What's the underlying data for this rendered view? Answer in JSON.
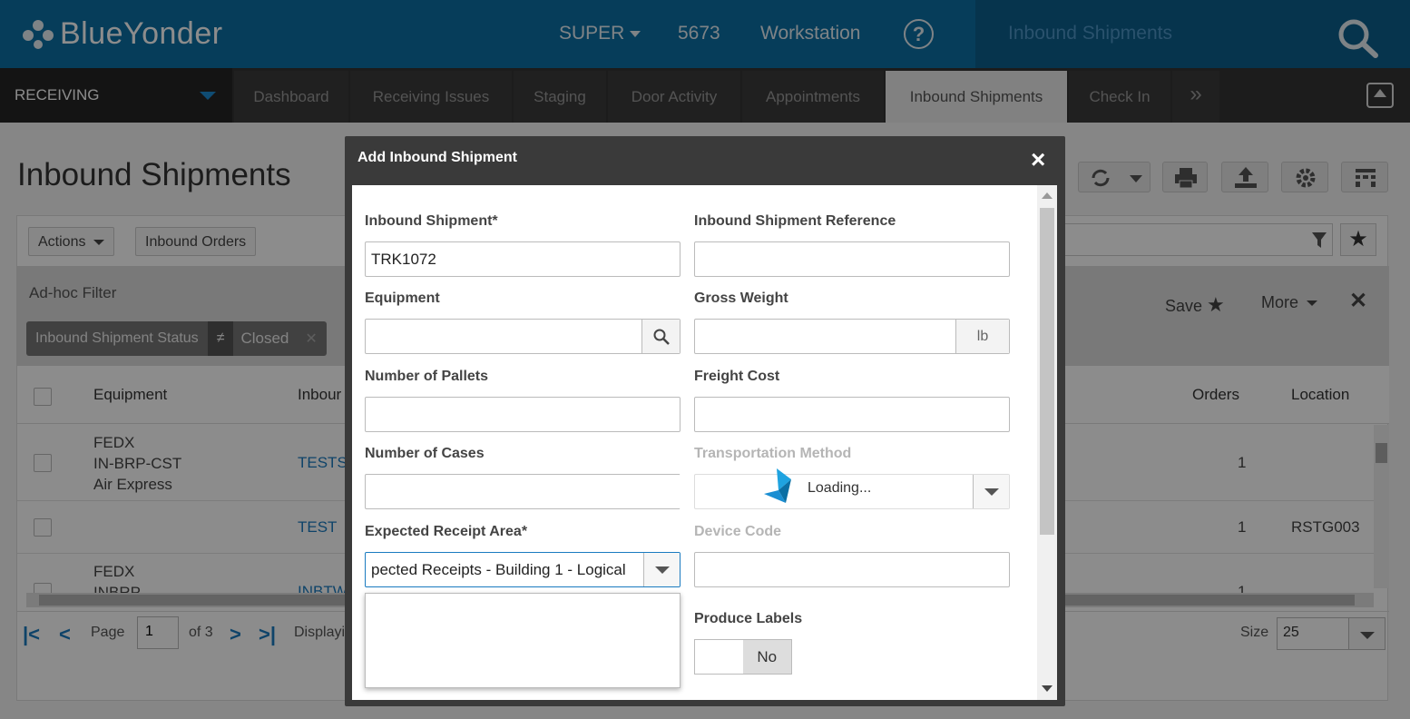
{
  "header": {
    "brand": "BlueYonder",
    "user": "SUPER",
    "warehouse": "5673",
    "workstation": "Workstation",
    "help": "?",
    "search_value": "Inbound Shipments"
  },
  "nav": {
    "module": "RECEIVING",
    "tabs": [
      {
        "label": "Dashboard"
      },
      {
        "label": "Receiving Issues"
      },
      {
        "label": "Staging"
      },
      {
        "label": "Door Activity"
      },
      {
        "label": "Appointments"
      },
      {
        "label": "Inbound Shipments"
      },
      {
        "label": "Check In"
      }
    ],
    "more": "»",
    "active_tab": "Inbound Shipments"
  },
  "page": {
    "title": "Inbound Shipments",
    "actions_label": "Actions",
    "inbound_orders_label": "Inbound Orders",
    "filter": {
      "title": "Ad-hoc Filter",
      "chip_field": "Inbound Shipment Status",
      "chip_op": "≠",
      "chip_value": "Closed",
      "save_label": "Save",
      "more_label": "More"
    },
    "columns": [
      "Equipment",
      "Inbour",
      "Orders",
      "Location"
    ],
    "rows": [
      {
        "equipment_l1": "FEDX",
        "equipment_l2": "IN-BRP-CST",
        "equipment_l3": "Air Express",
        "shipment": "TESTS",
        "orders": "1",
        "location": ""
      },
      {
        "equipment_l1": "",
        "equipment_l2": "",
        "equipment_l3": "",
        "shipment": "TEST",
        "orders": "1",
        "location": "RSTG003"
      },
      {
        "equipment_l1": "FEDX",
        "equipment_l2": "INBRP",
        "equipment_l3": "",
        "shipment": "INBTW",
        "orders": "1",
        "location": ""
      }
    ],
    "pager": {
      "page_label": "Page",
      "page_value": "1",
      "of_label": "of 3",
      "display_label": "Displayi",
      "size_label": "Size",
      "size_value": "25"
    }
  },
  "modal": {
    "title": "Add Inbound Shipment",
    "close": "×",
    "fields": {
      "inbound_shipment_label": "Inbound Shipment*",
      "inbound_shipment_value": "TRK1072",
      "reference_label": "Inbound Shipment Reference",
      "reference_value": "",
      "equipment_label": "Equipment",
      "gross_weight_label": "Gross Weight",
      "gross_weight_unit": "lb",
      "pallets_label": "Number of Pallets",
      "freight_cost_label": "Freight Cost",
      "cases_label": "Number of Cases",
      "transport_label": "Transportation Method",
      "loading_text": "Loading...",
      "receipt_area_label": "Expected Receipt Area*",
      "receipt_area_value": "pected Receipts - Building 1 - Logical",
      "device_code_label": "Device Code",
      "produce_labels_label": "Produce Labels",
      "produce_labels_value": "No"
    }
  }
}
